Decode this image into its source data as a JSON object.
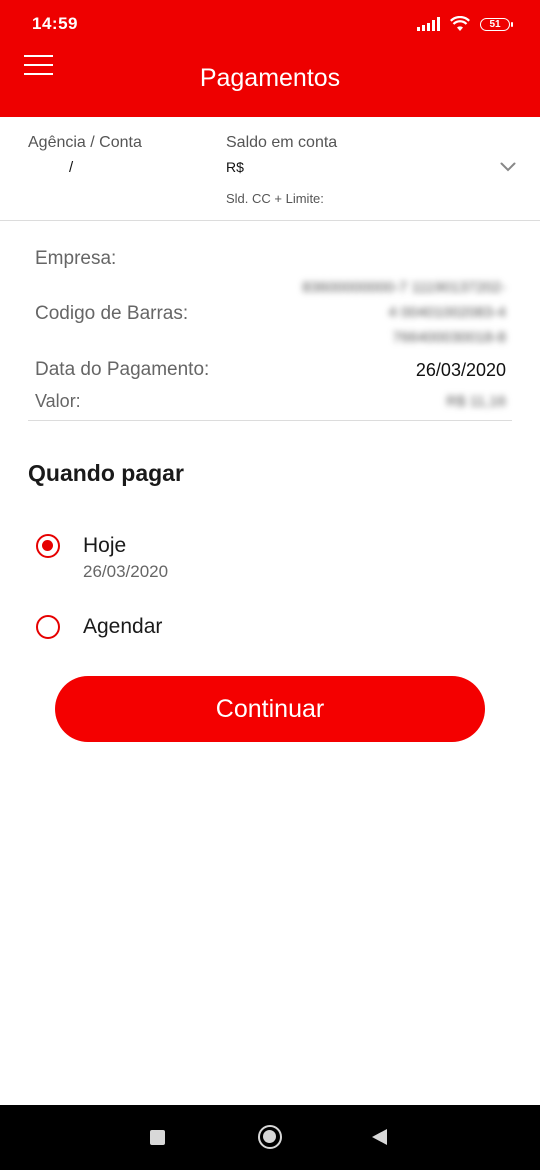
{
  "status_bar": {
    "time": "14:59",
    "battery": "51",
    "icons": [
      "signal-icon",
      "wifi-icon",
      "battery-icon"
    ]
  },
  "header": {
    "title": "Pagamentos",
    "menu_icon": "menu-icon",
    "background_color": "#ee0000"
  },
  "account": {
    "agencia_label": "Agência / Conta",
    "agencia_value": "/",
    "saldo_label": "Saldo em conta",
    "saldo_value": "R$",
    "limite_label": "Sld. CC + Limite:",
    "expand_icon": "chevron-down-icon"
  },
  "details": {
    "empresa_label": "Empresa:",
    "codigo_label": "Codigo de Barras:",
    "codigo_lines": [
      "83600000000-7 11190137202-",
      "4 00401002083-4",
      "766400030018-8"
    ],
    "data_label": "Data do Pagamento:",
    "data_value": "26/03/2020",
    "valor_label": "Valor:",
    "valor_value": "R$ 11,16"
  },
  "when_to_pay": {
    "title": "Quando pagar",
    "options": [
      {
        "label": "Hoje",
        "sublabel": "26/03/2020",
        "selected": true
      },
      {
        "label": "Agendar",
        "selected": false
      }
    ]
  },
  "actions": {
    "continue_label": "Continuar",
    "accent_color": "#f40000"
  },
  "nav_bar": {
    "icons": [
      "recent-apps-icon",
      "home-icon",
      "back-icon"
    ]
  }
}
